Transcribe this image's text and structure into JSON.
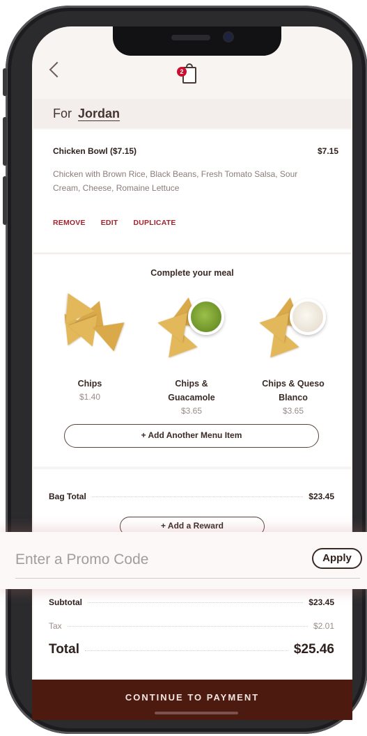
{
  "header": {
    "bag_count": "2"
  },
  "order_for": {
    "prefix": "For",
    "name": "Jordan"
  },
  "item": {
    "title": "Chicken Bowl ($7.15)",
    "price": "$7.15",
    "description": "Chicken with Brown Rice, Black Beans, Fresh Tomato Salsa, Sour Cream, Cheese, Romaine Lettuce",
    "actions": [
      "REMOVE",
      "EDIT",
      "DUPLICATE"
    ]
  },
  "complete_meal": {
    "heading": "Complete your meal",
    "items": [
      {
        "name": "Chips",
        "price": "$1.40",
        "image": "chips"
      },
      {
        "name": "Chips & Guacamole",
        "price": "$3.65",
        "image": "chips-guacamole"
      },
      {
        "name": "Chips & Queso Blanco",
        "price": "$3.65",
        "image": "chips-queso"
      }
    ],
    "add_item_label": "+ Add Another Menu Item"
  },
  "bag_total": {
    "label": "Bag Total",
    "value": "$23.45",
    "add_reward_label": "+ Add a Reward"
  },
  "promo": {
    "placeholder": "Enter a Promo Code",
    "apply_label": "Apply"
  },
  "summary": {
    "subtotal_label": "Subtotal",
    "subtotal_value": "$23.45",
    "tax_label": "Tax",
    "tax_value": "$2.01",
    "total_label": "Total",
    "total_value": "$25.46"
  },
  "continue_label": "CONTINUE TO PAYMENT",
  "colors": {
    "brand_dark": "#4d1a10",
    "accent_red": "#a3242d",
    "badge_red": "#c8102e"
  }
}
